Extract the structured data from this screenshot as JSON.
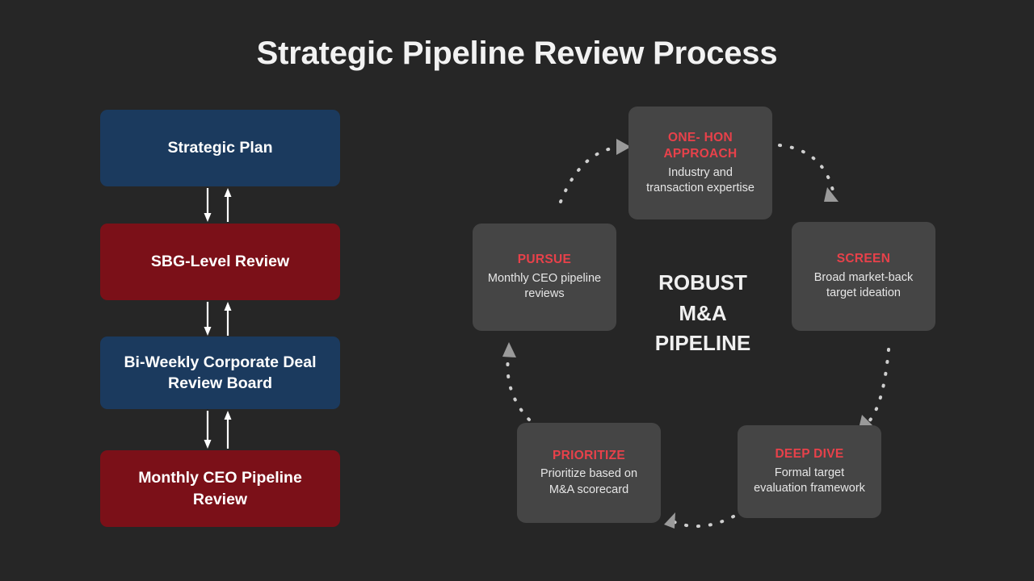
{
  "slide": {
    "title": "Strategic Pipeline Review Process",
    "background_color": "#262626"
  },
  "colors": {
    "background": "#262626",
    "blue_box": "#1b3a5e",
    "red_box": "#7b1018",
    "card_gray": "#454545",
    "accent_red": "#e8414a",
    "text_light": "#f2f2f2",
    "arrow_white": "#ffffff",
    "dotted_arc": "#cfcfcf"
  },
  "flowchart": {
    "name": "Strategic Pipeline Review governance flow",
    "boxes": [
      {
        "label": "Strategic Plan",
        "color": "blue"
      },
      {
        "label": "SBG-Level Review",
        "color": "red"
      },
      {
        "label": "Bi-Weekly Corporate Deal Review Board",
        "color": "blue"
      },
      {
        "label": "Monthly CEO Pipeline Review",
        "color": "red"
      }
    ],
    "connectors": [
      {
        "down": "down-arrow",
        "up": "up-arrow"
      },
      {
        "down": "down-arrow",
        "up": "up-arrow"
      },
      {
        "down": "down-arrow",
        "up": "up-arrow"
      }
    ]
  },
  "cycle": {
    "center_label": "ROBUST\nM&A\nPIPELINE",
    "nodes": [
      {
        "title": "ONE- HON APPROACH",
        "desc": "Industry and transaction expertise"
      },
      {
        "title": "SCREEN",
        "desc": "Broad market-back target ideation"
      },
      {
        "title": "DEEP DIVE",
        "desc": "Formal target evaluation framework"
      },
      {
        "title": "PRIORITIZE",
        "desc": "Prioritize based on M&A scorecard"
      },
      {
        "title": "PURSUE",
        "desc": "Monthly CEO pipeline reviews"
      }
    ],
    "arcs": [
      {
        "from": "PURSUE",
        "to": "ONE- HON APPROACH",
        "style": "dotted",
        "arrowhead": "right"
      },
      {
        "from": "ONE- HON APPROACH",
        "to": "SCREEN",
        "style": "dotted",
        "arrowhead": "down-right"
      },
      {
        "from": "SCREEN",
        "to": "DEEP DIVE",
        "style": "dotted",
        "arrowhead": "down-left"
      },
      {
        "from": "DEEP DIVE",
        "to": "PRIORITIZE",
        "style": "dotted",
        "arrowhead": "left"
      },
      {
        "from": "PRIORITIZE",
        "to": "PURSUE",
        "style": "dotted",
        "arrowhead": "up"
      }
    ]
  }
}
